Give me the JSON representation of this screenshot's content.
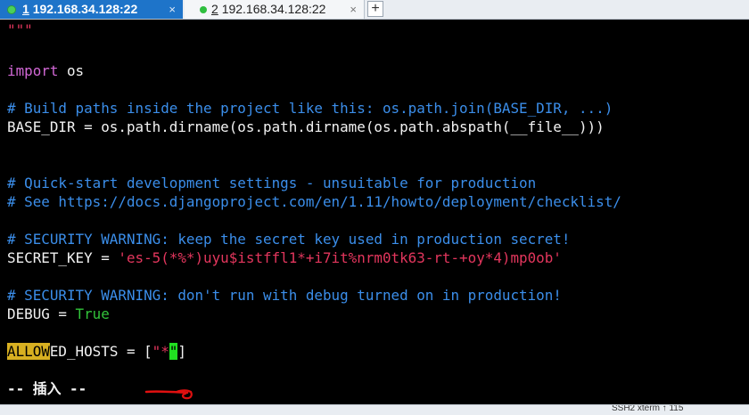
{
  "tabs": [
    {
      "number": "1",
      "title": "192.168.34.128:22",
      "close": "×"
    },
    {
      "number": "2",
      "title": "192.168.34.128:22",
      "close": "×"
    }
  ],
  "add_tab_label": "+",
  "editor": {
    "l1": "\"\"\"",
    "import_kw": "import",
    "import_rest": " os",
    "comment_build": "# Build paths inside the project like this: os.path.join(BASE_DIR, ...)",
    "base_dir": "BASE_DIR = os.path.dirname(os.path.dirname(os.path.abspath(__file__)))",
    "comment_quick": "# Quick-start development settings - unsuitable for production",
    "comment_see": "# See https://docs.djangoproject.com/en/1.11/howto/deployment/checklist/",
    "comment_sec1": "# SECURITY WARNING: keep the secret key used in production secret!",
    "secret_key_name": "SECRET_KEY = ",
    "secret_key_value": "'es-5(*%*)uyu$istffl1*+i7it%nrm0tk63-rt-+oy*4)mp0ob'",
    "comment_sec2": "# SECURITY WARNING: don't run with debug turned on in production!",
    "debug_name": "DEBUG = ",
    "debug_value": "True",
    "allowed_match": "ALLOW",
    "allowed_rest": "ED_HOSTS = [",
    "allowed_quote": "\"*",
    "allowed_cursor": "\"",
    "allowed_close": "]",
    "mode_line": "-- 插入 --"
  },
  "status": {
    "text": "SSH2  xterm  ↑ 115"
  },
  "colors": {
    "tab_active": "#1e74c9",
    "string": "#e3365d",
    "keyword": "#d268d6",
    "comment": "#3b8eea",
    "boolean": "#32c43a",
    "search_highlight": "#d8b021",
    "cursor": "#21e021",
    "annotation": "#e01010"
  }
}
